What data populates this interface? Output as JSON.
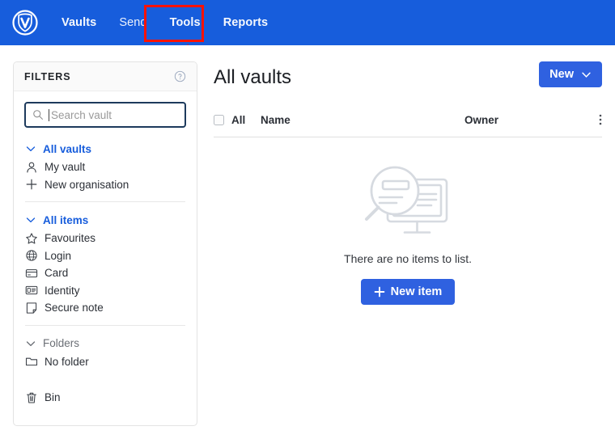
{
  "brand": {
    "logo_icon": "vault-shield-logo-icon",
    "header_color": "#175DDC",
    "accent_color": "#2F61E0",
    "annotation_color": "#FF1200"
  },
  "topnav": {
    "items": [
      {
        "label": "Vaults",
        "active": true
      },
      {
        "label": "Send",
        "active": false
      },
      {
        "label": "Tools",
        "active": false
      },
      {
        "label": "Reports",
        "active": false
      }
    ],
    "highlighted_item": "Tools"
  },
  "annotation": {
    "box_target": "Tools",
    "arrow_icon": "red-up-arrow-icon",
    "color": "#FF1200"
  },
  "sidebar": {
    "title": "FILTERS",
    "help_icon": "question-circle-icon",
    "search": {
      "placeholder": "Search vault",
      "value": "",
      "icon": "search-icon",
      "focused": true
    },
    "vault_group": {
      "header": "All vaults",
      "chevron_icon": "chevron-down-icon",
      "items": [
        {
          "label": "My vault",
          "icon": "person-icon"
        },
        {
          "label": "New organisation",
          "icon": "plus-icon"
        }
      ]
    },
    "items_group": {
      "header": "All items",
      "chevron_icon": "chevron-down-icon",
      "items": [
        {
          "label": "Favourites",
          "icon": "star-icon"
        },
        {
          "label": "Login",
          "icon": "globe-icon"
        },
        {
          "label": "Card",
          "icon": "credit-card-icon"
        },
        {
          "label": "Identity",
          "icon": "id-card-icon"
        },
        {
          "label": "Secure note",
          "icon": "note-icon"
        }
      ]
    },
    "folders_group": {
      "header": "Folders",
      "chevron_icon": "chevron-down-icon",
      "items": [
        {
          "label": "No folder",
          "icon": "folder-icon"
        }
      ]
    },
    "trash": {
      "label": "Bin",
      "icon": "trash-icon"
    }
  },
  "main": {
    "page_title": "All vaults",
    "new_button": {
      "label": "New",
      "chevron_icon": "chevron-down-icon"
    },
    "table": {
      "select_all_label": "All",
      "columns": [
        "Name",
        "Owner"
      ],
      "options_icon": "vertical-dots-icon",
      "rows": []
    },
    "empty_state": {
      "illustration_icon": "magnifier-over-monitor-icon",
      "message": "There are no items to list.",
      "button_label": "New item",
      "button_icon": "plus-icon"
    }
  }
}
